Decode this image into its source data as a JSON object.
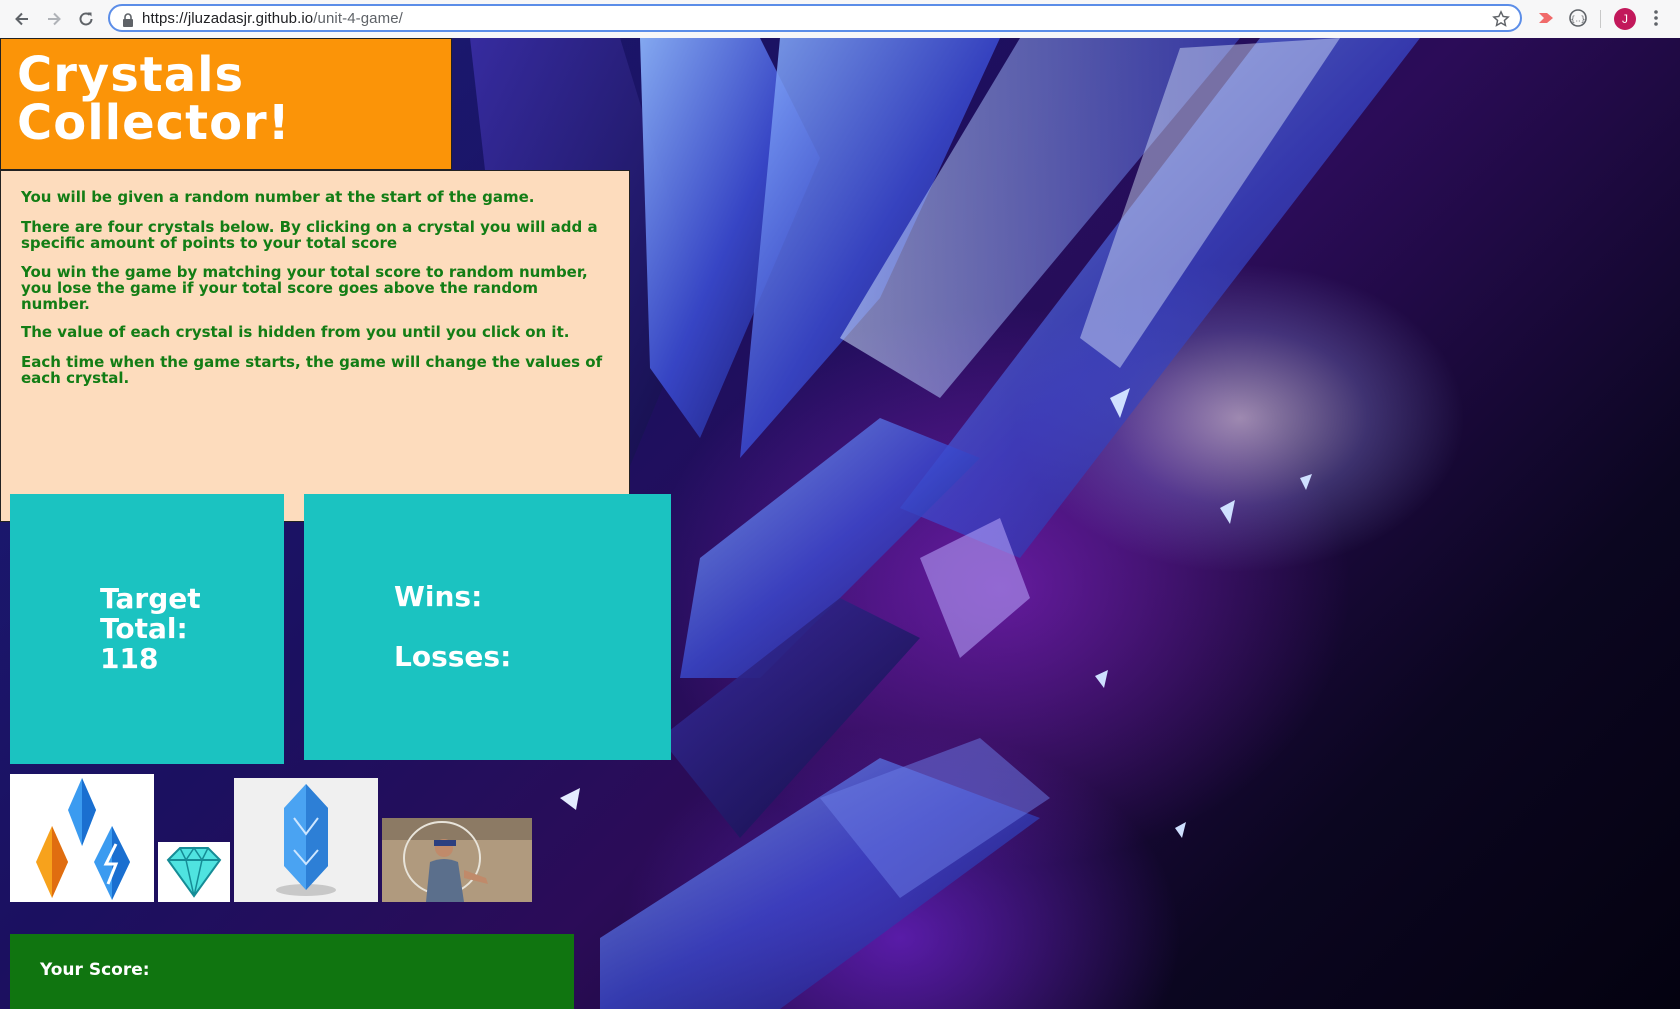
{
  "browser": {
    "url_host": "https://jluzadasjr.github.io",
    "url_path": "/unit-4-game/",
    "profile_initial": "J"
  },
  "page": {
    "title_line1": "Crystals",
    "title_line2": "Collector!",
    "instructions": [
      "You will be given a random number at the start of the game.",
      "There are four crystals below. By clicking on a crystal you will add a specific amount of points to your total score",
      "You win the game by matching your total score to random number, you lose the game if your total score goes above the random number.",
      "The value of each crystal is hidden from you until you click on it.",
      "Each time when the game starts, the game will change the values of each crystal."
    ],
    "target_label_1": "Target",
    "target_label_2": "Total:",
    "target_value": "118",
    "wins_label": "Wins:",
    "losses_label": "Losses:",
    "score_label": "Your Score:",
    "crystals": [
      "three-crystals-image",
      "diamond-image",
      "blue-crystal-image",
      "man-with-lasso-image"
    ]
  },
  "colors": {
    "title_bg": "#fb9408",
    "instructions_bg": "#fddcbd",
    "instructions_text": "#137d15",
    "stat_bg": "#1bc3c1",
    "score_bg": "#107510"
  }
}
